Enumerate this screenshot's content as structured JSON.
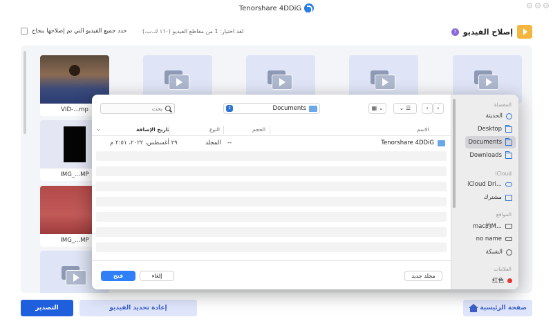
{
  "app": {
    "title": "Tenorshare 4DDiG"
  },
  "header": {
    "section_title": "إصلاح الفيديو",
    "help": "?",
    "selection_info": "لقد اختيار: 1 من مقاطع الفيديو (١٦٠ ك.ب.)",
    "select_all_label": "حدد جميع الفيديو التي تم إصلاحها بنجاح"
  },
  "videos": [
    {
      "name": "VID-...mp"
    },
    {
      "name": ""
    },
    {
      "name": ""
    },
    {
      "name": ""
    },
    {
      "name": ""
    },
    {
      "name": "IMG_...MP"
    },
    {
      "name": "IMG_...MP"
    },
    {
      "name": ""
    }
  ],
  "bottom_bar": {
    "export_label": "التصدير",
    "reselect_label": "إعادة تحديد الفيديو",
    "home_label": "صفحة الرئيسية"
  },
  "dialog": {
    "search": {
      "placeholder": "بحث"
    },
    "location": "Documents",
    "grid_btn": "▦ ⌄",
    "list_btn": "⌄ ☰",
    "back": "‹",
    "forward": "›",
    "columns": {
      "name": "الاسم",
      "size": "الحجم",
      "kind": "النوع",
      "date_added": "تاريخ الإضافة"
    },
    "rows": [
      {
        "name": "Tenorshare 4DDiG",
        "size": "--",
        "kind": "المجلد",
        "date_added": "٢٩ أغسطس، ٢٠٢٢، ٢:٥١ م"
      }
    ],
    "sidebar": {
      "favorites_heading": "المفضلة",
      "favorites": [
        {
          "label": "الحديثة",
          "icon": "clock-icon"
        },
        {
          "label": "Desktop",
          "icon": "folder-icon"
        },
        {
          "label": "Documents",
          "icon": "folder-icon",
          "active": true
        },
        {
          "label": "Downloads",
          "icon": "folder-icon"
        }
      ],
      "icloud_heading": "iCloud",
      "icloud": [
        {
          "label": "iCloud Dri...",
          "icon": "cloud-icon"
        },
        {
          "label": "مشترك",
          "icon": "shared-folder-icon"
        }
      ],
      "locations_heading": "المواقع",
      "locations": [
        {
          "label": "mac的M...",
          "icon": "monitor-icon"
        },
        {
          "label": "no name",
          "icon": "drive-icon"
        },
        {
          "label": "الشبكة",
          "icon": "globe-icon"
        }
      ],
      "tags_heading": "العلامات",
      "tags": [
        {
          "label": "红色",
          "icon": "red-tag-icon",
          "color": "#e8332d"
        }
      ]
    },
    "footer": {
      "open_label": "فتح",
      "cancel_label": "إلغاء",
      "new_folder_label": "مجلد جديد"
    }
  },
  "colors": {
    "accent": "#1f5fde",
    "secondary_bg": "#dfe5fb",
    "dialog_primary": "#2f7ff7"
  }
}
